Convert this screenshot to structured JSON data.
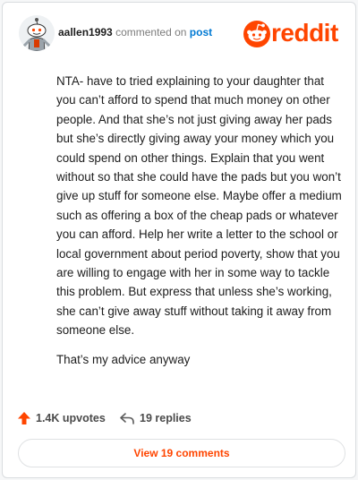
{
  "header": {
    "username": "aallen1993",
    "commented_text": "commented on",
    "post_link": "post",
    "brand": "reddit"
  },
  "comment": {
    "paragraphs": [
      "NTA- have to tried explaining to your daughter that you can’t afford to spend that much money on other people. And that she’s not just giving away her pads but she’s directly giving away your money which you could spend on other things. Explain that you went without so that she could have the pads but you won’t give up stuff for someone else. Maybe offer a medium such as offering a box of the cheap pads or whatever you can afford. Help her write a letter to the school or local government about period poverty, show that you are willing to engage with her in some way to tackle this problem. But express that unless she’s working, she can’t give away stuff without taking it away from someone else.",
      "That’s my advice anyway"
    ]
  },
  "actions": {
    "upvotes": "1.4K upvotes",
    "replies": "19 replies"
  },
  "view_comments": "View 19 comments",
  "colors": {
    "brand": "#ff4500",
    "link": "#0079d3"
  },
  "icons": [
    "avatar",
    "reddit-snoo-icon",
    "upvote-arrow-icon",
    "reply-arrow-icon"
  ]
}
